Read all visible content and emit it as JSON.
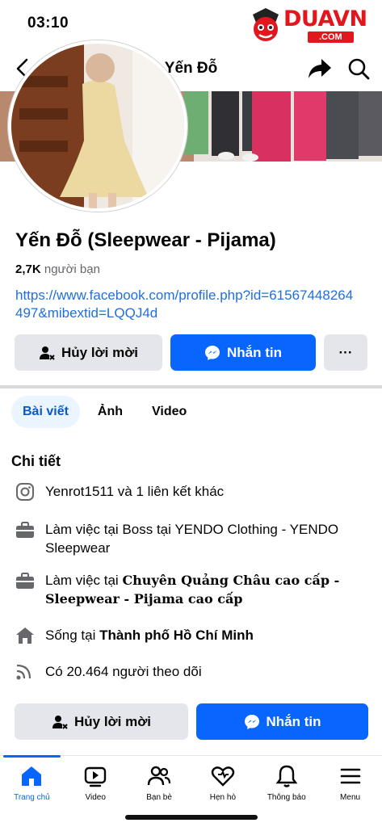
{
  "status_bar": {
    "time": "03:10"
  },
  "watermark": {
    "brand": "DUAVN",
    "sub": ".COM"
  },
  "nav": {
    "title": "Yến Đỗ"
  },
  "profile": {
    "name": "Yến Đỗ (Sleepwear - Pijama)",
    "friends_count": "2,7K",
    "friends_label": "người bạn",
    "link": "https://www.facebook.com/profile.php?id=61567448264497&mibextid=LQQJ4d"
  },
  "actions": {
    "cancel_request": "Hủy lời mời",
    "message": "Nhắn tin",
    "more": "···"
  },
  "tabs": [
    {
      "label": "Bài viết",
      "active": true
    },
    {
      "label": "Ảnh",
      "active": false
    },
    {
      "label": "Video",
      "active": false
    }
  ],
  "details": {
    "title": "Chi tiết",
    "instagram": "Yenrot1511 và 1 liên kết khác",
    "work1": "Làm việc tại Boss tại YENDO Clothing - YENDO Sleepwear",
    "work2_prefix": "Làm việc tại ",
    "work2_bold": "Chuyên Quảng Châu cao cấp - Sleepwear - Pijama cao cấp",
    "lives_prefix": "Sống tại ",
    "lives_bold": "Thành phố Hồ Chí Minh",
    "followers": "Có 20.464 người theo dõi"
  },
  "bottom_nav": [
    {
      "label": "Trang chủ",
      "icon": "home-icon",
      "active": true
    },
    {
      "label": "Video",
      "icon": "video-icon",
      "active": false
    },
    {
      "label": "Bạn bè",
      "icon": "friends-icon",
      "active": false
    },
    {
      "label": "Hẹn hò",
      "icon": "dating-icon",
      "active": false
    },
    {
      "label": "Thông báo",
      "icon": "bell-icon",
      "active": false
    },
    {
      "label": "Menu",
      "icon": "menu-icon",
      "active": false
    }
  ],
  "colors": {
    "accent": "#0866ff",
    "link": "#216fdb",
    "tab_active_bg": "#ebf5ff"
  }
}
